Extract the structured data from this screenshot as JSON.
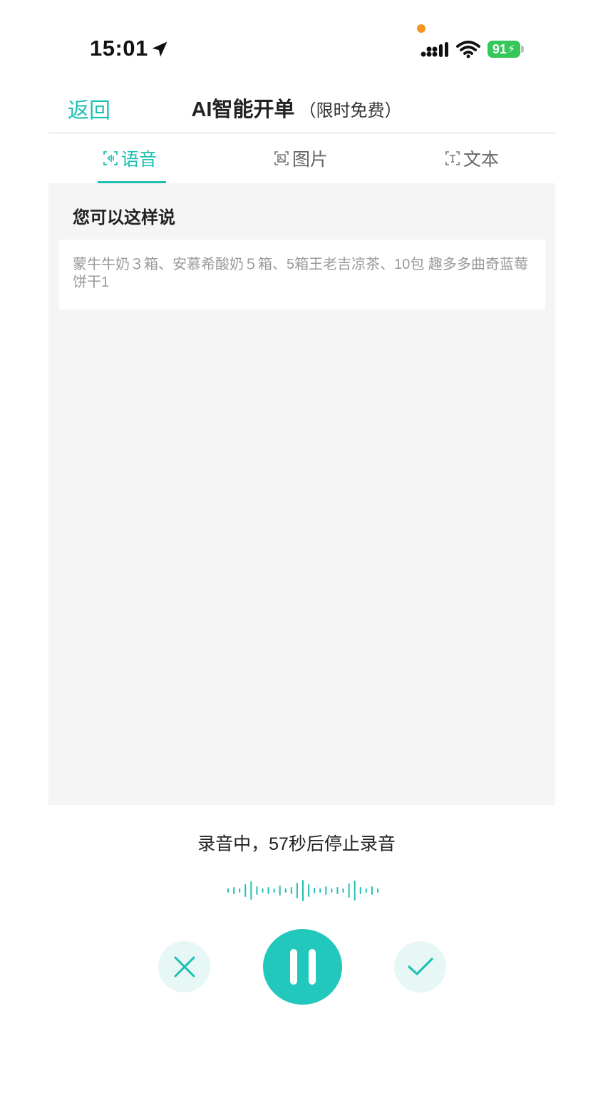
{
  "status_bar": {
    "time": "15:01",
    "battery": "91",
    "icons": [
      "location-arrow-icon",
      "signal-icon",
      "wifi-icon",
      "battery-charging-icon"
    ]
  },
  "header": {
    "back_label": "返回",
    "title": "AI智能开单",
    "title_suffix": "（限时免费）"
  },
  "tabs": [
    {
      "label": "语音",
      "icon": "voice-scan-icon",
      "active": true
    },
    {
      "label": "图片",
      "icon": "image-scan-icon",
      "active": false
    },
    {
      "label": "文本",
      "icon": "text-scan-icon",
      "active": false
    }
  ],
  "content": {
    "hint_heading": "您可以这样说",
    "example_text": "蒙牛牛奶３箱、安慕希酸奶５箱、5箱王老吉凉茶、10包 趣多多曲奇蓝莓饼干1"
  },
  "recording": {
    "status_text": "录音中，57秒后停止录音",
    "buttons": [
      "close-icon",
      "pause-icon",
      "check-icon"
    ]
  },
  "colors": {
    "accent": "#1fc0b4",
    "accent_strong": "#21c8bb",
    "accent_light": "#e6f7f5",
    "panel_bg": "#f5f5f5",
    "battery_green": "#34c759",
    "recording_dot": "#f7931e"
  }
}
